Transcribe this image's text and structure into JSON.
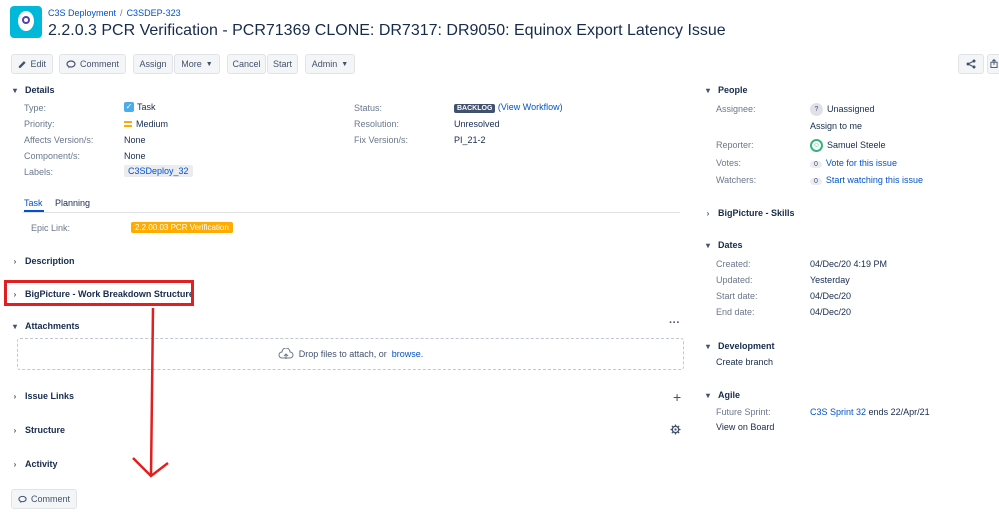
{
  "header": {
    "breadcrumb_project": "C3S Deployment",
    "breadcrumb_sep": "/",
    "breadcrumb_issue": "C3SDEP-323",
    "title": "2.2.0.3 PCR Verification - PCR71369 CLONE: DR7317: DR9050: Equinox Export Latency Issue"
  },
  "toolbar": {
    "edit": "Edit",
    "comment": "Comment",
    "assign": "Assign",
    "more": "More",
    "cancel": "Cancel",
    "start": "Start",
    "admin": "Admin"
  },
  "details": {
    "title": "Details",
    "type_label": "Type:",
    "type_value": "Task",
    "priority_label": "Priority:",
    "priority_value": "Medium",
    "affects_label": "Affects Version/s:",
    "affects_value": "None",
    "component_label": "Component/s:",
    "component_value": "None",
    "labels_label": "Labels:",
    "labels_value": "C3SDeploy_32",
    "status_label": "Status:",
    "status_value": "BACKLOG",
    "status_link": "(View Workflow)",
    "resolution_label": "Resolution:",
    "resolution_value": "Unresolved",
    "fix_label": "Fix Version/s:",
    "fix_value": "PI_21-2"
  },
  "tabs": {
    "task": "Task",
    "planning": "Planning"
  },
  "epic": {
    "label": "Epic Link:",
    "value": "2.2.00.03 PCR Verification"
  },
  "sections": {
    "description": "Description",
    "wbs": "BigPicture - Work Breakdown Structure",
    "attachments": "Attachments",
    "issue_links": "Issue Links",
    "structure": "Structure",
    "activity": "Activity"
  },
  "attachments": {
    "drop_text": "Drop files to attach, or",
    "browse": "browse."
  },
  "footer": {
    "comment": "Comment"
  },
  "people": {
    "title": "People",
    "assignee_label": "Assignee:",
    "assignee_value": "Unassigned",
    "assign_to_me": "Assign to me",
    "reporter_label": "Reporter:",
    "reporter_value": "Samuel Steele",
    "votes_label": "Votes:",
    "votes_count": "0",
    "votes_link": "Vote for this issue",
    "watchers_label": "Watchers:",
    "watchers_count": "0",
    "watchers_link": "Start watching this issue"
  },
  "skills": {
    "title": "BigPicture - Skills"
  },
  "dates": {
    "title": "Dates",
    "created_label": "Created:",
    "created_value": "04/Dec/20 4:19 PM",
    "updated_label": "Updated:",
    "updated_value": "Yesterday",
    "start_label": "Start date:",
    "start_value": "04/Dec/20",
    "end_label": "End date:",
    "end_value": "04/Dec/20"
  },
  "development": {
    "title": "Development",
    "create_branch": "Create branch"
  },
  "agile": {
    "title": "Agile",
    "future_label": "Future Sprint:",
    "sprint_link": "C3S Sprint 32",
    "sprint_ends": "ends 22/Apr/21",
    "view_board": "View on Board"
  },
  "colors": {
    "accent": "#0052cc",
    "annotation": "#e02020",
    "epic": "#ffab00"
  },
  "icons": [
    "pencil-icon",
    "speech-bubble-icon",
    "chevron-down-icon",
    "share-icon",
    "export-icon",
    "checkbox-icon",
    "equals-icon",
    "ellipsis-icon",
    "upload-cloud-icon",
    "plus-icon",
    "gear-icon",
    "question-avatar-icon",
    "user-avatar-icon"
  ]
}
